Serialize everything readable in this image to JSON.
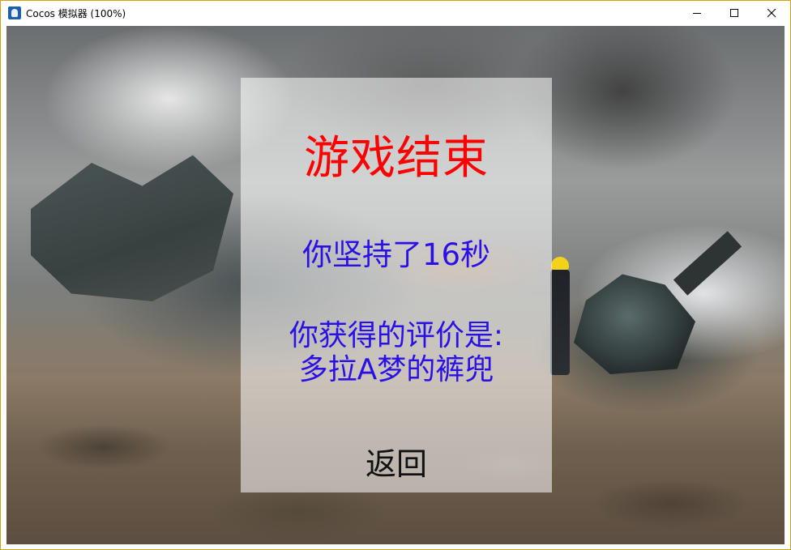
{
  "window": {
    "title": "Cocos 模拟器 (100%)",
    "icon": "cocos-app-icon",
    "controls": [
      "minimize-icon",
      "maximize-icon",
      "close-icon"
    ]
  },
  "game_over": {
    "title": "游戏结束",
    "title_color": "#ff0000",
    "survived": "你坚持了16秒",
    "rating_label": "你获得的评价是:",
    "rating_value": "多拉A梦的裤兜",
    "text_color": "#2b10e6",
    "back_button": "返回"
  }
}
